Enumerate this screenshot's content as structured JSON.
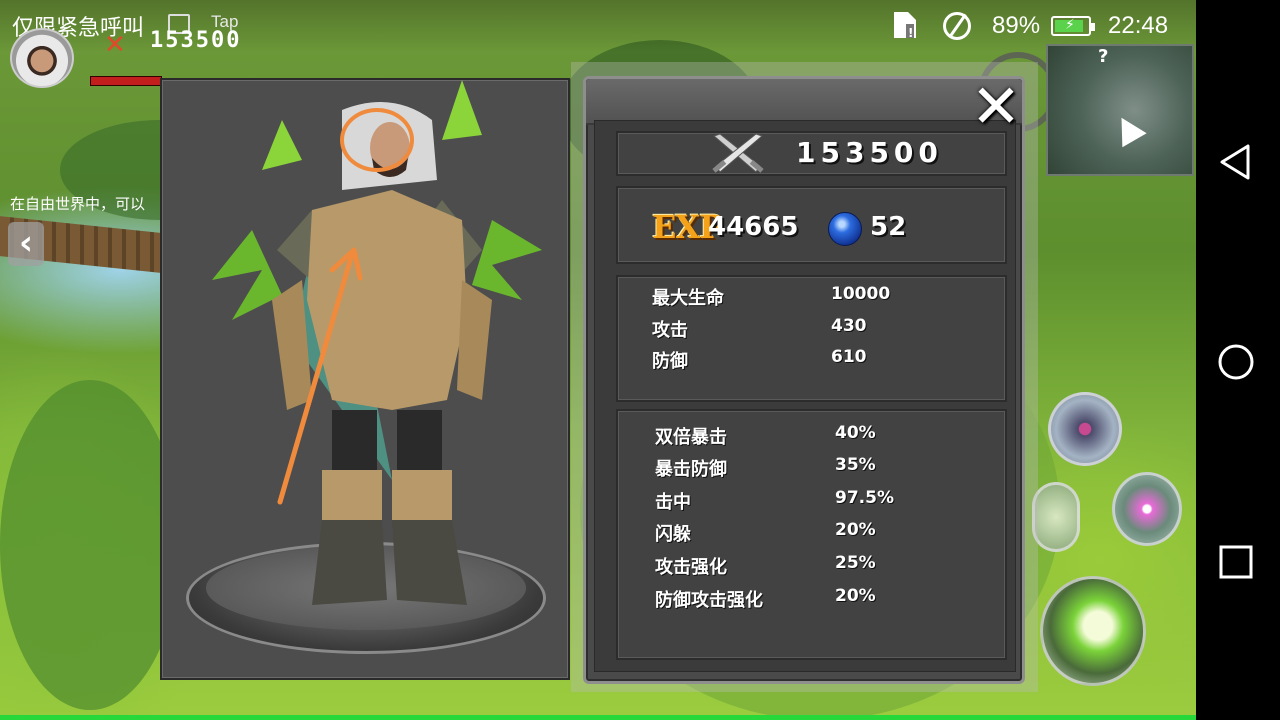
{
  "status_bar": {
    "emergency_text": "仅限紧急呼叫",
    "tap_label": "Tap",
    "battery_percent": "89%",
    "battery_level": 0.89,
    "time": "22:48"
  },
  "hud": {
    "power": "153500",
    "notice": "在自由世界中，可以"
  },
  "stats": {
    "close_label": "✕",
    "power_value": "153500",
    "exp_label": "EXP",
    "exp_value": "44665",
    "gem_value": "52",
    "base": [
      {
        "label": "最大生命",
        "value": "10000"
      },
      {
        "label": "攻击",
        "value": "430"
      },
      {
        "label": "防御",
        "value": "610"
      }
    ],
    "advanced": [
      {
        "label": "双倍暴击",
        "value": "40%"
      },
      {
        "label": "暴击防御",
        "value": "35%"
      },
      {
        "label": "击中",
        "value": "97.5%"
      },
      {
        "label": "闪躲",
        "value": "20%"
      },
      {
        "label": "攻击强化",
        "value": "25%"
      },
      {
        "label": "防御攻击强化",
        "value": "20%"
      }
    ]
  },
  "colors": {
    "accent_orange": "#f08a3c",
    "exp_gold": "#f3a21a",
    "hp_red": "#c21e1e",
    "battery_green": "#5bd24b"
  }
}
